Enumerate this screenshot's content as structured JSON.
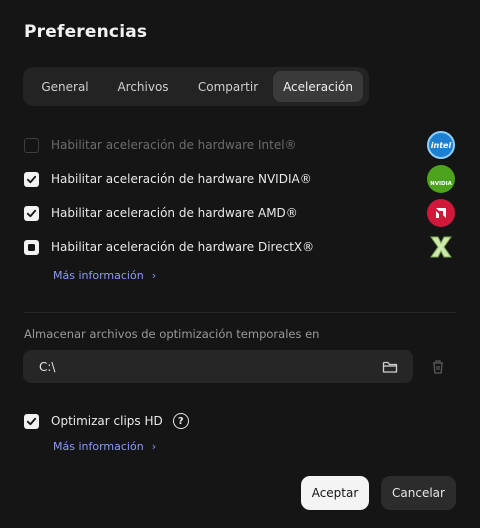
{
  "dialog": {
    "title": "Preferencias"
  },
  "tabs": [
    {
      "label": "General",
      "active": false
    },
    {
      "label": "Archivos",
      "active": false
    },
    {
      "label": "Compartir",
      "active": false
    },
    {
      "label": "Aceleración",
      "active": true
    }
  ],
  "acceleration": {
    "options": [
      {
        "label": "Habilitar aceleración de hardware Intel®",
        "state": "disabled",
        "vendor_icon": "intel-icon"
      },
      {
        "label": "Habilitar aceleración de hardware NVIDIA®",
        "state": "checked",
        "vendor_icon": "nvidia-icon"
      },
      {
        "label": "Habilitar aceleración de hardware AMD®",
        "state": "checked",
        "vendor_icon": "amd-icon"
      },
      {
        "label": "Habilitar aceleración de hardware DirectX®",
        "state": "indeterminate",
        "vendor_icon": "directx-icon"
      }
    ],
    "more_info": "Más información"
  },
  "temp_files": {
    "label": "Almacenar archivos de optimización temporales en",
    "path": "C:\\",
    "folder_icon": "folder-icon",
    "trash_icon": "trash-icon"
  },
  "hd_clips": {
    "label": "Optimizar clips HD",
    "checked": true,
    "help_icon": "help-icon",
    "more_info": "Más información"
  },
  "buttons": {
    "accept": "Aceptar",
    "cancel": "Cancelar"
  },
  "vendor_marks": {
    "intel": "intel",
    "nvidia": "NVIDIA",
    "amd": "AMD"
  },
  "colors": {
    "background": "#151515",
    "link": "#8b9cf5",
    "intel": "#1e7fd0",
    "nvidia": "#4ea31d",
    "amd": "#d0193a"
  }
}
